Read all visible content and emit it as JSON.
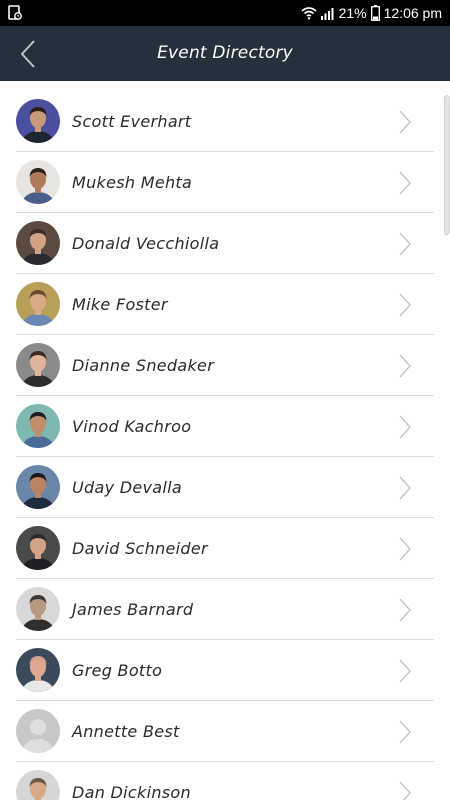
{
  "status_bar": {
    "battery": "21%",
    "time": "12:06 pm",
    "icons": [
      "notification-icon",
      "wifi-icon",
      "signal-icon",
      "battery-icon"
    ]
  },
  "header": {
    "title": "Event Directory",
    "back_icon": "back-arrow-icon"
  },
  "colors": {
    "header_bg": "#24313d",
    "status_bg": "#000000",
    "divider": "#dcdcdc",
    "text": "#2b2b2b",
    "chevron": "#bdbdbd"
  },
  "people": [
    {
      "name": "Scott Everhart",
      "avatar_bg": "#4a4fa0",
      "skin": "#c89a7a",
      "hair": "#2a1e16",
      "shirt": "#1d2630"
    },
    {
      "name": "Mukesh Mehta",
      "avatar_bg": "#e8e4e0",
      "skin": "#b07a5a",
      "hair": "#2a2320",
      "shirt": "#4a5e8c"
    },
    {
      "name": "Donald Vecchiolla",
      "avatar_bg": "#5a4a40",
      "skin": "#d2a486",
      "hair": "#3a2f28",
      "shirt": "#2a2a30"
    },
    {
      "name": "Mike Foster",
      "avatar_bg": "#b8a058",
      "skin": "#d8aa86",
      "hair": "#6a4e2e",
      "shirt": "#6a88b0"
    },
    {
      "name": "Dianne Snedaker",
      "avatar_bg": "#8a8a8a",
      "skin": "#e0b49a",
      "hair": "#3a2a22",
      "shirt": "#2c2c2c"
    },
    {
      "name": "Vinod Kachroo",
      "avatar_bg": "#7fb8b0",
      "skin": "#c08e6a",
      "hair": "#1e1e1e",
      "shirt": "#4a6a9a"
    },
    {
      "name": "Uday Devalla",
      "avatar_bg": "#6a86a8",
      "skin": "#b88462",
      "hair": "#1a1a1a",
      "shirt": "#1e2a3e"
    },
    {
      "name": "David Schneider",
      "avatar_bg": "#4a4a4a",
      "skin": "#d4a284",
      "hair": "#2a2a2a",
      "shirt": "#1e1e26"
    },
    {
      "name": "James Barnard",
      "avatar_bg": "#d8d8d8",
      "skin": "#b89880",
      "hair": "#3a3a3a",
      "shirt": "#2e2e2e"
    },
    {
      "name": "Greg Botto",
      "avatar_bg": "#3a4a5a",
      "skin": "#e0a890",
      "hair": "#d0a090",
      "shirt": "#e8e8e8"
    },
    {
      "name": "Annette Best",
      "avatar_bg": "#c8c8c8",
      "skin": "#dedede",
      "hair": "#dedede",
      "shirt": "#dedede",
      "placeholder": true
    },
    {
      "name": "Dan Dickinson",
      "avatar_bg": "#d6d6d6",
      "skin": "#d8a888",
      "hair": "#6a5a4a",
      "shirt": "#8a9aaa"
    }
  ]
}
